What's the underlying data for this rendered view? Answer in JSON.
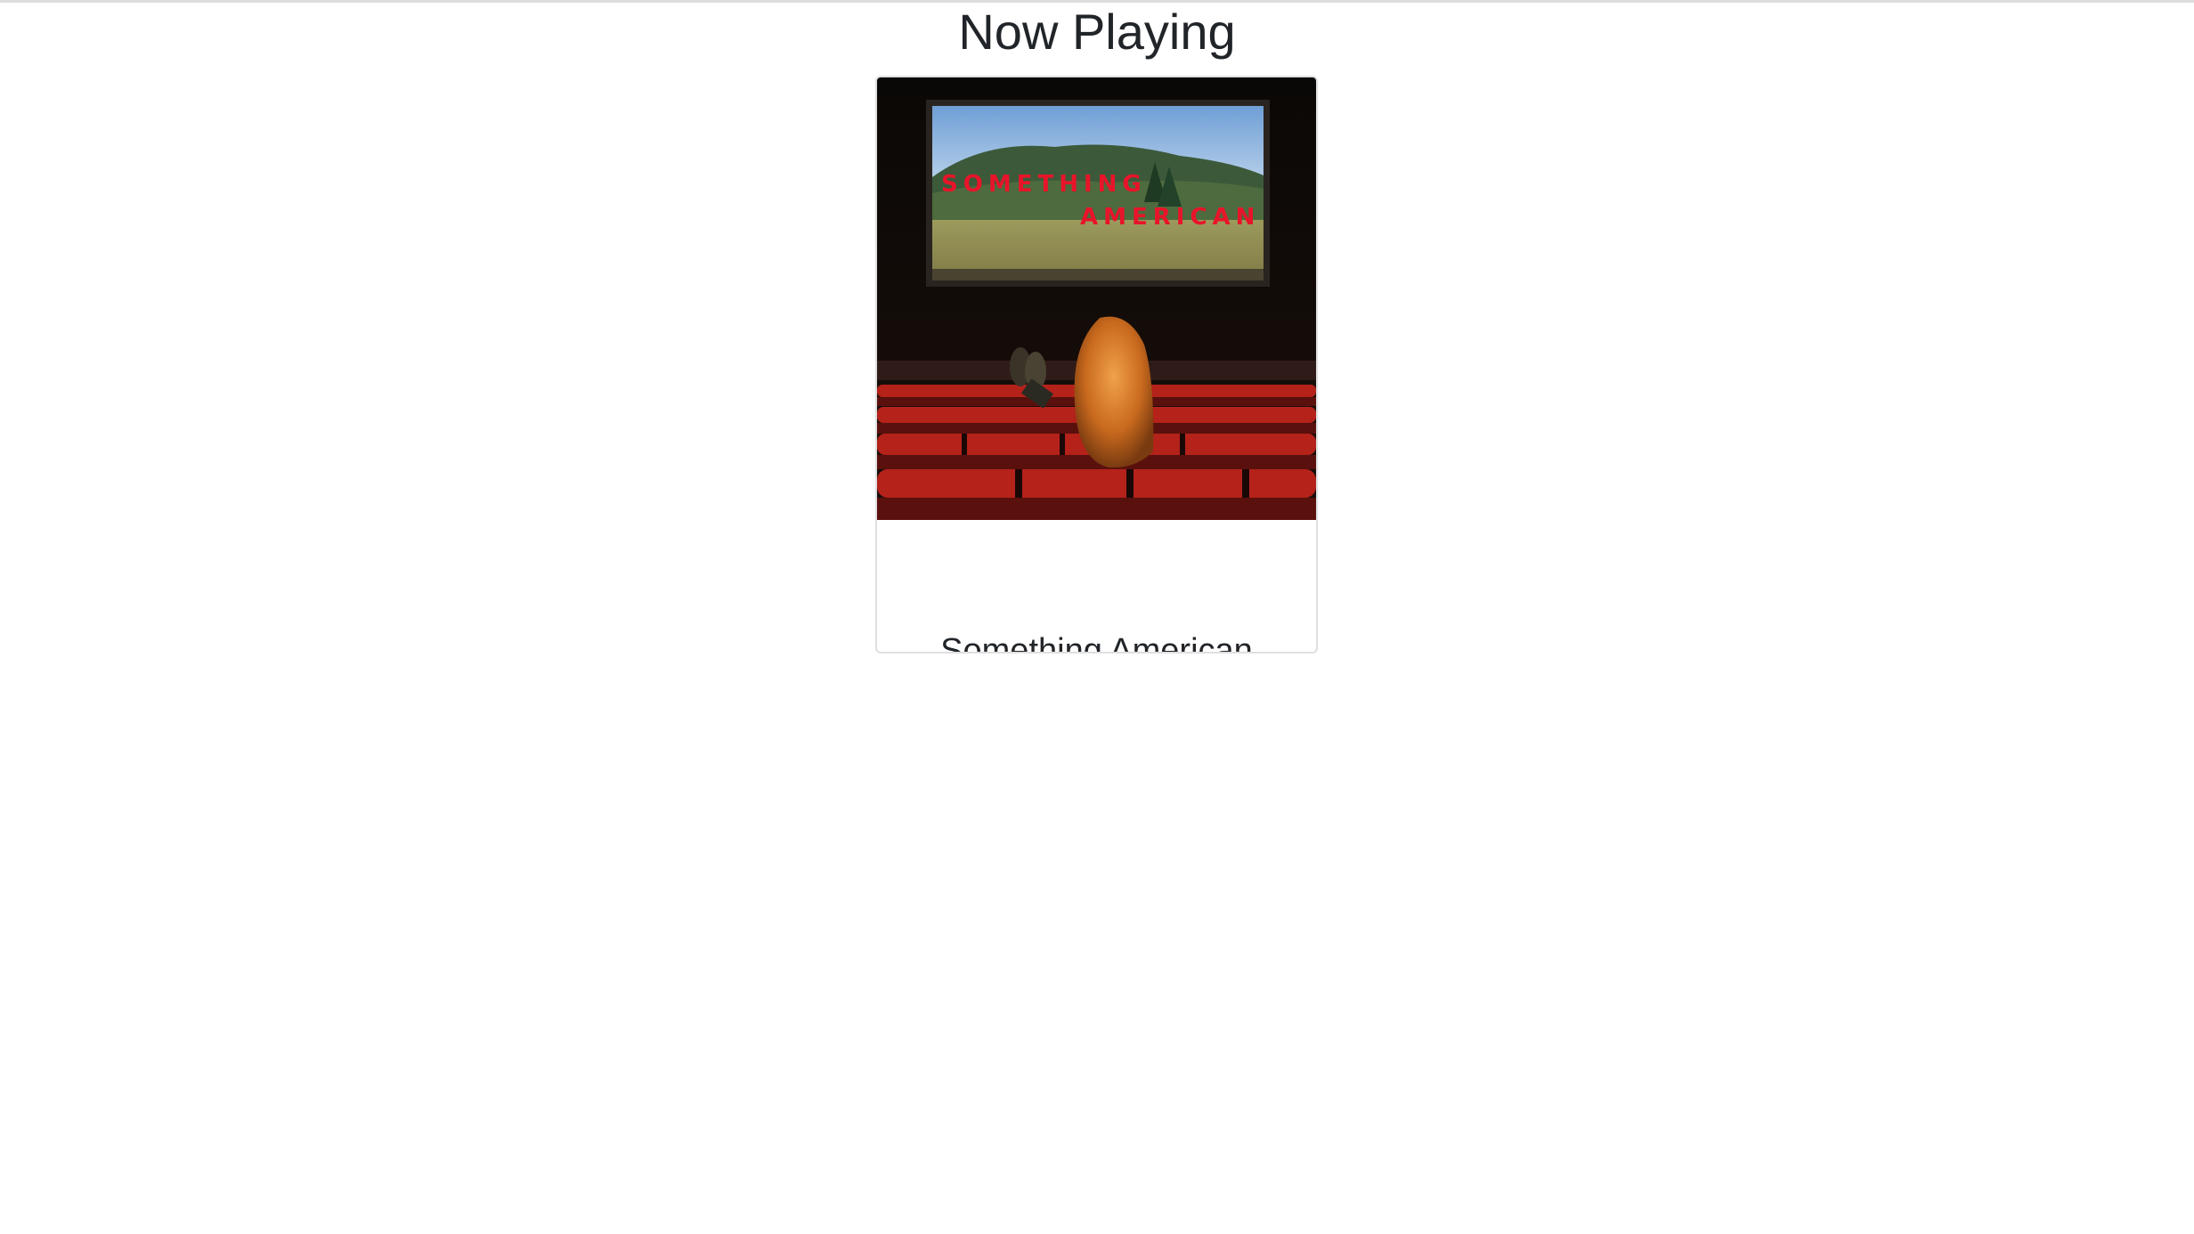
{
  "page": {
    "title": "Now Playing"
  },
  "now_playing": {
    "album_title": "Something American",
    "cover_art": {
      "icon": "album-cover-image",
      "text_line1": "SOMETHING",
      "text_line2": "AMERICAN",
      "text_color": "#e8142a"
    }
  }
}
